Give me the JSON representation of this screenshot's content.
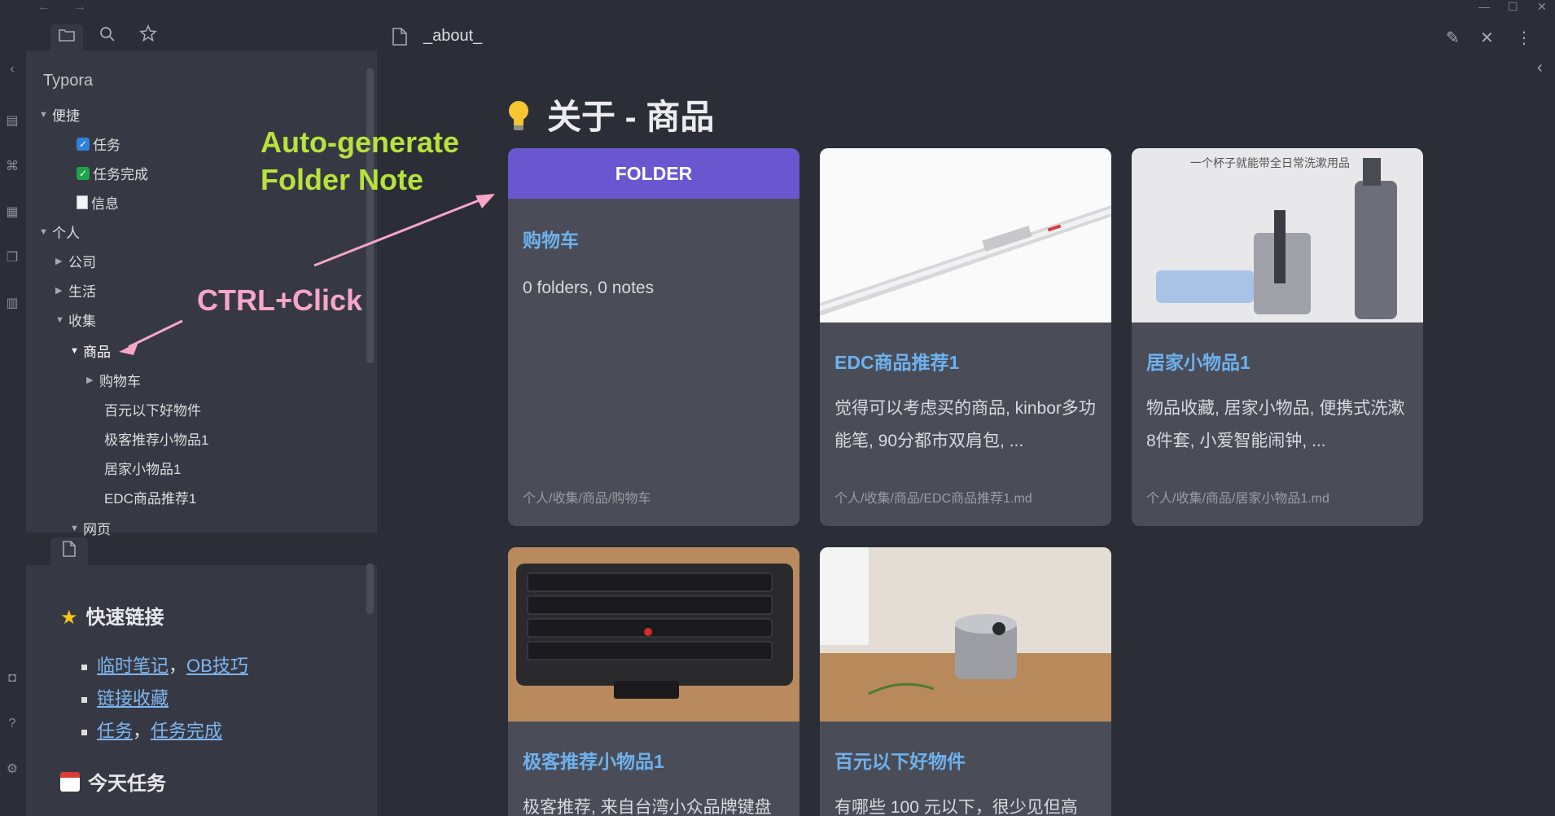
{
  "window": {
    "back": "←",
    "forward": "→",
    "minimize": "—",
    "maximize": "☐",
    "close": "✕"
  },
  "sidebar": {
    "vault_title": "Typora",
    "tree": [
      {
        "label": "便捷",
        "type": "folder-open"
      },
      {
        "label": "任务",
        "type": "check-blue"
      },
      {
        "label": "任务完成",
        "type": "check-green"
      },
      {
        "label": "信息",
        "type": "doc"
      },
      {
        "label": "个人",
        "type": "folder-open"
      },
      {
        "label": "公司",
        "type": "folder-closed"
      },
      {
        "label": "生活",
        "type": "folder-closed"
      },
      {
        "label": "收集",
        "type": "folder-open"
      },
      {
        "label": "商品",
        "type": "folder-open"
      },
      {
        "label": "购物车",
        "type": "folder-closed"
      },
      {
        "label": "百元以下好物件",
        "type": "file"
      },
      {
        "label": "极客推荐小物品1",
        "type": "file"
      },
      {
        "label": "居家小物品1",
        "type": "file"
      },
      {
        "label": "EDC商品推荐1",
        "type": "file"
      },
      {
        "label": "网页",
        "type": "folder-open"
      }
    ]
  },
  "lower_panel": {
    "quick_links_title": "快速链接",
    "links": [
      [
        "临时笔记",
        "OB技巧"
      ],
      [
        "链接收藏"
      ],
      [
        "任务",
        "任务完成"
      ]
    ],
    "link_separator": "，",
    "today_title": "今天任务"
  },
  "header": {
    "file_title": "_about_"
  },
  "main": {
    "title": "关于 - 商品"
  },
  "annotations": {
    "green_line1": "Auto-generate",
    "green_line2": "Folder Note",
    "pink": "CTRL+Click"
  },
  "cards": [
    {
      "badge": "FOLDER",
      "title": "购物车",
      "desc": "0 folders, 0 notes",
      "path": "个人/收集/商品/购物车"
    },
    {
      "title": "EDC商品推荐1",
      "desc": "觉得可以考虑买的商品, kinbor多功能笔, 90分都市双肩包, ...",
      "path": "个人/收集/商品/EDC商品推荐1.md"
    },
    {
      "title": "居家小物品1",
      "desc": "物品收藏, 居家小物品, 便携式洗漱8件套, 小爱智能闹钟, ...",
      "path": "个人/收集/商品/居家小物品1.md",
      "img_caption": "一个杯子就能带全日常洗漱用品"
    },
    {
      "title": "极客推荐小物品1",
      "desc": "极客推荐, 来自台湾小众品牌键盘"
    },
    {
      "title": "百元以下好物件",
      "desc": "有哪些 100 元以下，很少见但高"
    }
  ],
  "colors": {
    "bg": "#2b2e37",
    "panel": "#363944",
    "card": "#4a4d57",
    "link": "#6eb1ee",
    "folder_accent": "#6a56cf",
    "anno_green": "#b8e23c",
    "anno_pink": "#f7a6c8"
  }
}
